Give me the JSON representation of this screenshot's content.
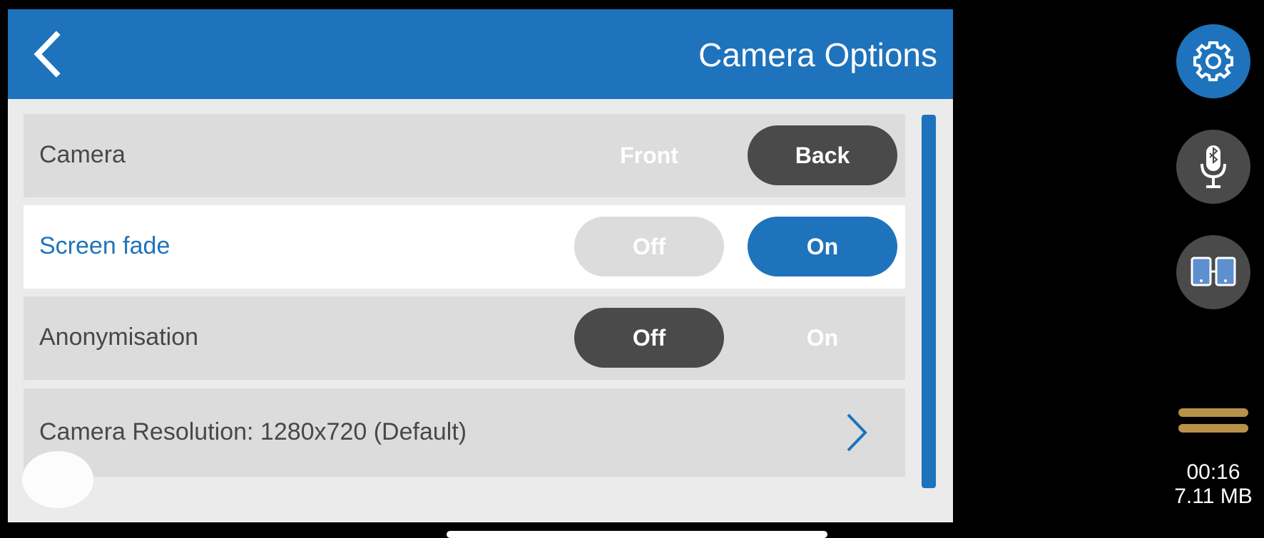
{
  "header": {
    "title": "Camera Options"
  },
  "rows": [
    {
      "label": "Camera",
      "options": [
        "Front",
        "Back"
      ],
      "selected": "Back"
    },
    {
      "label": "Screen fade",
      "options": [
        "Off",
        "On"
      ],
      "selected": "On"
    },
    {
      "label": "Anonymisation",
      "options": [
        "Off",
        "On"
      ],
      "selected": "Off"
    },
    {
      "label": "Camera Resolution: 1280x720 (Default)"
    }
  ],
  "sidebar": {
    "buttons": [
      "gear-icon",
      "bluetooth-mic-icon",
      "dual-screen-icon"
    ],
    "timer": "00:16",
    "size": "7.11 MB"
  },
  "colors": {
    "accent": "#1e73bc",
    "dark": "#4a4a4a",
    "row": "#dcdcdc",
    "panel": "#ebebeb",
    "gold": "#b8924a"
  }
}
